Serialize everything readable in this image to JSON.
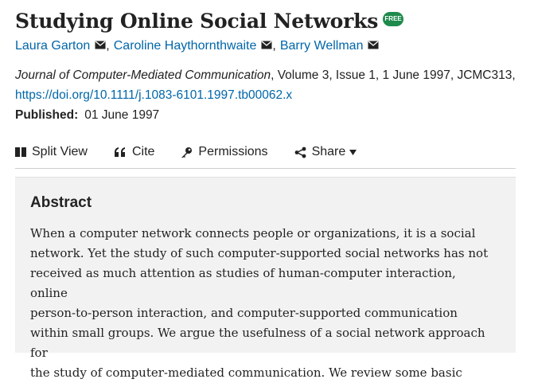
{
  "article": {
    "title": "Studying Online Social Networks",
    "badge": "FREE",
    "authors": [
      "Laura Garton",
      "Caroline Haythornthwaite",
      "Barry Wellman"
    ],
    "author_separator": ",",
    "journal": "Journal of Computer-Mediated Communication",
    "citation_rest": ", Volume 3, Issue 1, 1 June 1997, JCMC313,",
    "doi": "https://doi.org/10.1111/j.1083-6101.1997.tb00062.x",
    "published_label": "Published:",
    "published_date": "01 June 1997"
  },
  "toolbar": {
    "split_view": "Split View",
    "cite": "Cite",
    "permissions": "Permissions",
    "share": "Share"
  },
  "abstract": {
    "heading": "Abstract",
    "lines": [
      "When a computer network connects people or organizations, it is a social",
      "network. Yet the study of such computer-supported social networks has not",
      "received as much attention as studies of human-computer interaction, online",
      "person-to-person interaction, and computer-supported communication",
      "within small groups. We argue the usefulness of a social network approach for",
      "the study of computer-mediated communication. We review some basic"
    ]
  },
  "colors": {
    "link": "#0066aa",
    "badge": "#1e8a4c",
    "abstract_bg": "#f2f2f2"
  },
  "icons": [
    "mail-icon",
    "split-view-icon",
    "quote-icon",
    "key-icon",
    "share-icon",
    "caret-down-icon"
  ]
}
